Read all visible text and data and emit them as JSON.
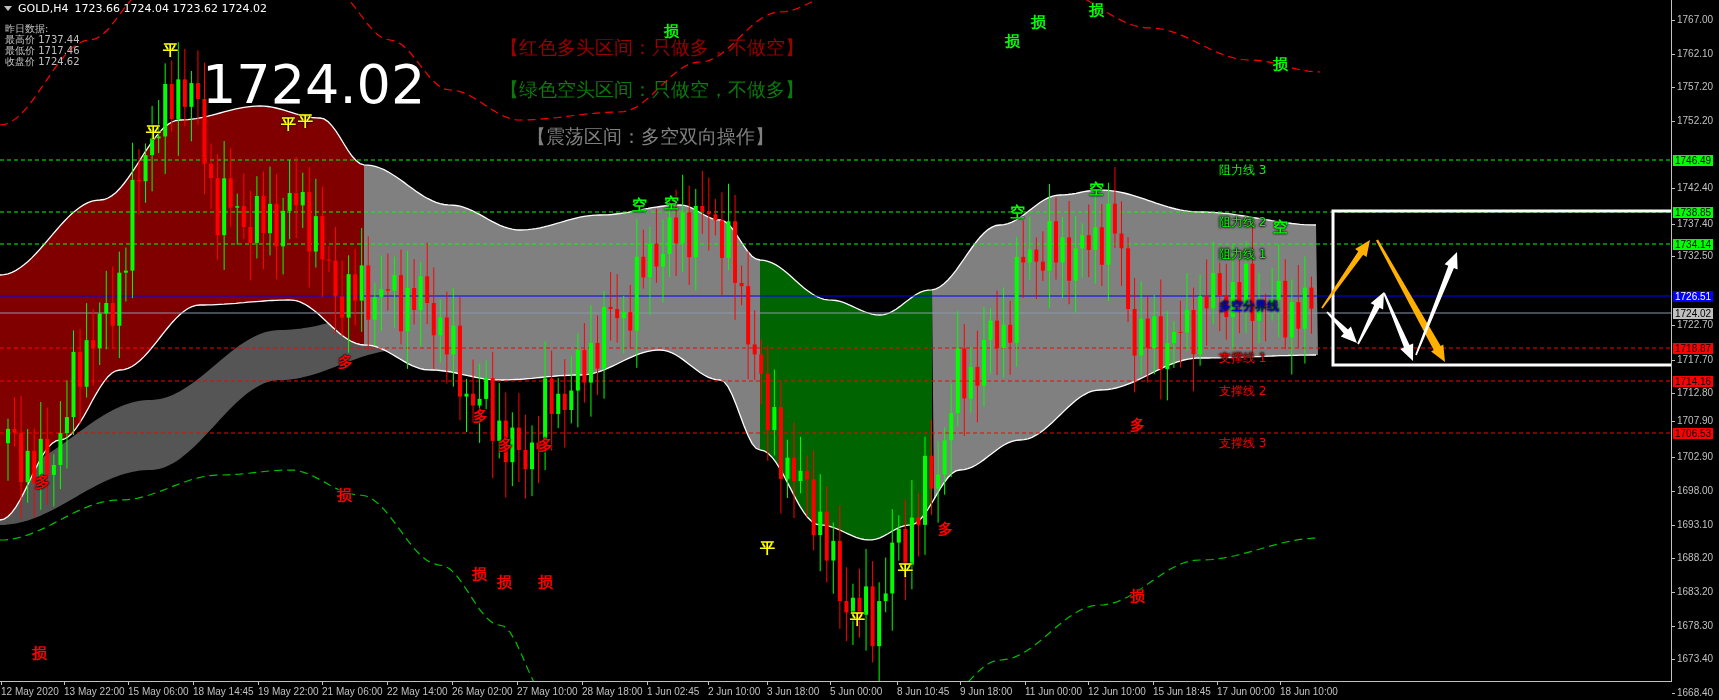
{
  "chart_header": {
    "symbol": "GOLD,H4",
    "ohlc": "1723.66 1724.04 1723.62 1724.02"
  },
  "yesterday_panel": {
    "title": "昨日数据:",
    "rows": [
      "最高价 1737.44",
      "最低价 1717.46",
      "收盘价 1724.62"
    ]
  },
  "current_price": "1724.02",
  "zone_legend": [
    {
      "text": "【红色多头区间：只做多，不做空】",
      "color": "#990000"
    },
    {
      "text": "【绿色空头区间：只做空，不做多】",
      "color": "#0a7a0a"
    },
    {
      "text": "【震荡区间：多空双向操作】",
      "color": "#808080"
    }
  ],
  "levels": [
    {
      "label": "阻力线 3",
      "kind": "resistance",
      "tag": "1746.49"
    },
    {
      "label": "阻力线 2",
      "kind": "resistance",
      "tag": "1738.85"
    },
    {
      "label": "阻力线 1",
      "kind": "resistance",
      "tag": "1734.14"
    },
    {
      "label": "多空分界线",
      "kind": "pivot",
      "tag": "1726.51"
    },
    {
      "kind": "current",
      "tag": "1724.02"
    },
    {
      "label": "支撑线 1",
      "kind": "support",
      "tag": "1718.87"
    },
    {
      "label": "支撑线 2",
      "kind": "support",
      "tag": "1714.16"
    },
    {
      "label": "支撑线 3",
      "kind": "support",
      "tag": "1706.53"
    }
  ],
  "price_axis": [
    "1767.00",
    "1762.10",
    "1757.20",
    "1752.20",
    "1742.40",
    "1737.40",
    "1732.50",
    "1722.70",
    "1717.70",
    "1712.80",
    "1707.90",
    "1702.90",
    "1698.00",
    "1693.10",
    "1688.20",
    "1683.20",
    "1678.30",
    "1673.40",
    "1668.40"
  ],
  "time_axis": [
    "12 May 2020",
    "13 May 22:00",
    "15 May 06:00",
    "18 May 14:45",
    "19 May 22:00",
    "21 May 06:00",
    "22 May 14:00",
    "26 May 02:00",
    "27 May 10:00",
    "28 May 18:00",
    "1 Jun 02:45",
    "2 Jun 10:00",
    "3 Jun 18:00",
    "5 Jun 00:00",
    "8 Jun 10:45",
    "9 Jun 18:00",
    "11 Jun 00:00",
    "12 Jun 10:00",
    "15 Jun 18:45",
    "17 Jun 00:00",
    "18 Jun 10:00"
  ],
  "signals": [
    {
      "text": "损",
      "color": "#00ff00"
    },
    {
      "text": "损",
      "color": "#00ff00"
    },
    {
      "text": "损",
      "color": "#00ff00"
    },
    {
      "text": "损",
      "color": "#00ff00"
    },
    {
      "text": "平",
      "color": "#ffff00"
    },
    {
      "text": "损",
      "color": "#00ff00"
    },
    {
      "text": "平",
      "color": "#ffff00"
    },
    {
      "text": "平",
      "color": "#ffff00"
    },
    {
      "text": "平",
      "color": "#ffff00"
    },
    {
      "text": "空",
      "color": "#00ff00"
    },
    {
      "text": "空",
      "color": "#00ff00"
    },
    {
      "text": "空",
      "color": "#00ff00"
    },
    {
      "text": "空",
      "color": "#00ff00"
    },
    {
      "text": "空",
      "color": "#00ff00"
    },
    {
      "text": "多",
      "color": "#ff0000"
    },
    {
      "text": "多",
      "color": "#ff0000"
    },
    {
      "text": "多",
      "color": "#ff0000"
    },
    {
      "text": "多",
      "color": "#ff0000"
    },
    {
      "text": "多",
      "color": "#ff0000"
    },
    {
      "text": "多",
      "color": "#ff0000"
    },
    {
      "text": "损",
      "color": "#ff0000"
    },
    {
      "text": "多",
      "color": "#ff0000"
    },
    {
      "text": "平",
      "color": "#ffff00"
    },
    {
      "text": "平",
      "color": "#ffff00"
    },
    {
      "text": "损",
      "color": "#ff0000"
    },
    {
      "text": "损",
      "color": "#ff0000"
    },
    {
      "text": "损",
      "color": "#ff0000"
    },
    {
      "text": "损",
      "color": "#ff0000"
    },
    {
      "text": "平",
      "color": "#ffff00"
    },
    {
      "text": "损",
      "color": "#ff0000"
    }
  ]
}
